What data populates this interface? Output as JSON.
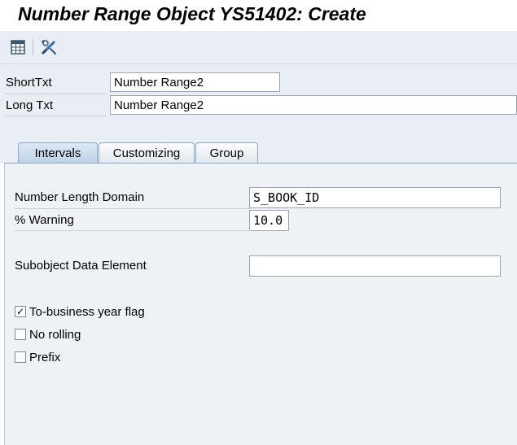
{
  "window": {
    "title": "Number Range Object YS51402: Create"
  },
  "toolbar": {
    "buttons": [
      {
        "name": "table-icon"
      },
      {
        "name": "settings-pen-icon"
      }
    ]
  },
  "header": {
    "short_text": {
      "label": "ShortTxt",
      "value": "Number Range2"
    },
    "long_text": {
      "label": "Long Txt",
      "value": "Number Range2"
    }
  },
  "tabs": [
    {
      "label": "Intervals",
      "active": true
    },
    {
      "label": "Customizing",
      "active": false
    },
    {
      "label": "Group",
      "active": false
    }
  ],
  "intervals": {
    "number_length_domain": {
      "label": "Number Length Domain",
      "value": "S_BOOK_ID"
    },
    "warning": {
      "label": "% Warning",
      "value": "10.0"
    },
    "subobject_data_element": {
      "label": "Subobject Data Element",
      "value": ""
    },
    "checkboxes": [
      {
        "label": "To-business year flag",
        "checked": true,
        "mark": "✓"
      },
      {
        "label": "No rolling",
        "checked": false,
        "mark": ""
      },
      {
        "label": "Prefix",
        "checked": false,
        "mark": ""
      }
    ]
  },
  "colors": {
    "toolbar_bg": "#e9eef4",
    "panel_bg": "#eef2f7",
    "tab_border": "#8ea6c0",
    "active_tab": "#bcd1e8"
  }
}
